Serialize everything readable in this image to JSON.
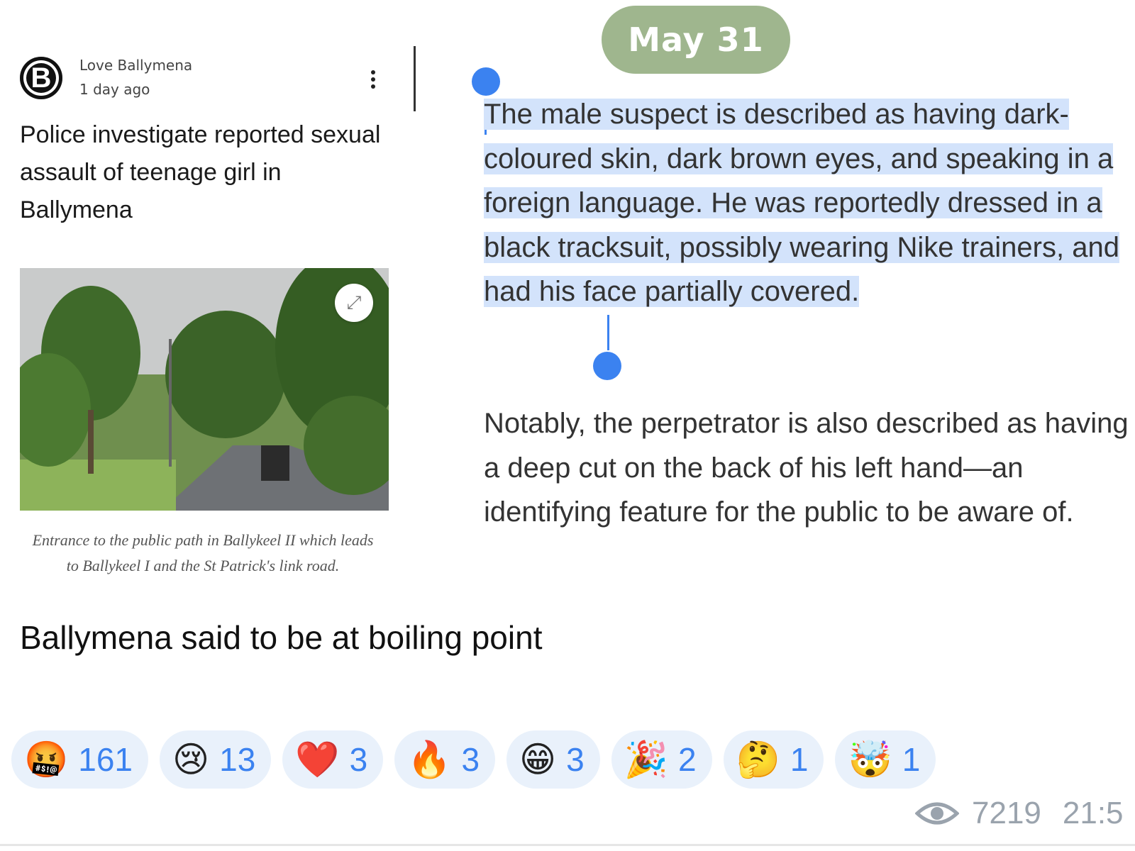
{
  "date_pill": "May 31",
  "article_card": {
    "avatar_letter": "B",
    "source": "Love Ballymena",
    "time": "1 day ago",
    "title": "Police investigate reported sexual assault of teenage girl in Ballymena",
    "caption": "Entrance to the public path in Ballykeel II which leads to Ballykeel I and the St Patrick's link road."
  },
  "message": {
    "paragraph_selected": "The male suspect is described as having dark-coloured skin, dark brown eyes, and speaking in a foreign language. He was reportedly dressed in a black tracksuit, possibly wearing Nike trainers, and had his face partially covered.",
    "paragraph_2": "Notably, the perpetrator is also described as having a deep cut on the back of his left hand—an identifying feature for the public to be aware of.",
    "headline": "Ballymena said to be at boiling point"
  },
  "reactions": [
    {
      "emoji": "🤬",
      "count": "161"
    },
    {
      "emoji": "😢",
      "count": "13"
    },
    {
      "emoji": "❤️",
      "count": "3"
    },
    {
      "emoji": "🔥",
      "count": "3"
    },
    {
      "emoji": "😁",
      "count": "3"
    },
    {
      "emoji": "🎉",
      "count": "2"
    },
    {
      "emoji": "🤔",
      "count": "1"
    },
    {
      "emoji": "🤯",
      "count": "1"
    }
  ],
  "footer": {
    "views": "7219",
    "time": "21:5"
  },
  "colors": {
    "accent": "#3b82f0",
    "date_pill": "#9fb68e",
    "selection": "#d3e3fb",
    "reaction_bg": "#e9f1fb"
  }
}
